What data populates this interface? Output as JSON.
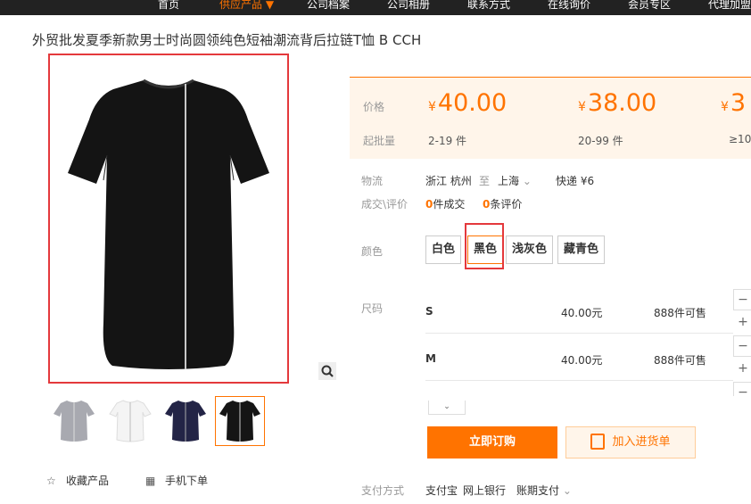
{
  "nav": {
    "items": [
      "首页",
      "供应产品",
      "公司档案",
      "公司相册",
      "联系方式",
      "在线询价",
      "会员专区",
      "代理加盟"
    ],
    "active_marker": "▼"
  },
  "product": {
    "title": "外贸批发夏季新款男士时尚圆领纯色短袖潮流背后拉链T恤 B CCH"
  },
  "gallery": {
    "main_image_desc": "黑色拉链T恤",
    "thumbnails": [
      "gray-tshirt",
      "white-tshirt",
      "navy-tshirt",
      "black-tshirt"
    ],
    "selected_index": 3,
    "zoom_icon": "search-icon"
  },
  "actions": {
    "favorite": "收藏产品",
    "mobile": "手机下单"
  },
  "pricing": {
    "price_label": "价格",
    "min_order_label": "起批量",
    "currency": "¥",
    "tiers": [
      {
        "price": "40.00",
        "qty": "2-19 件"
      },
      {
        "price": "38.00",
        "qty": "20-99 件"
      },
      {
        "price": "3",
        "qty": "≥10"
      }
    ]
  },
  "logistics": {
    "label": "物流",
    "from": "浙江 杭州",
    "to_word": "至",
    "to": "上海",
    "express": "快递 ¥6"
  },
  "deals": {
    "label": "成交\\评价",
    "deal_count": "0",
    "deal_suffix": "件成交",
    "review_count": "0",
    "review_suffix": "条评价"
  },
  "colors": {
    "label": "颜色",
    "options": [
      "白色",
      "黑色",
      "浅灰色",
      "藏青色"
    ],
    "selected": "黑色"
  },
  "sizes": {
    "label": "尺码",
    "rows": [
      {
        "size": "S",
        "price": "40.00元",
        "stock": "888件可售"
      },
      {
        "size": "M",
        "price": "40.00元",
        "stock": "888件可售"
      }
    ]
  },
  "buttons": {
    "order": "立即订购",
    "cart": "加入进货单"
  },
  "payment": {
    "label": "支付方式",
    "methods": [
      "支付宝",
      "网上银行",
      "账期支付"
    ]
  },
  "colors_theme": {
    "accent": "#ff7300",
    "highlight": "#e4393c",
    "nav_bg": "#222222",
    "price_bg": "#fff5ea"
  }
}
